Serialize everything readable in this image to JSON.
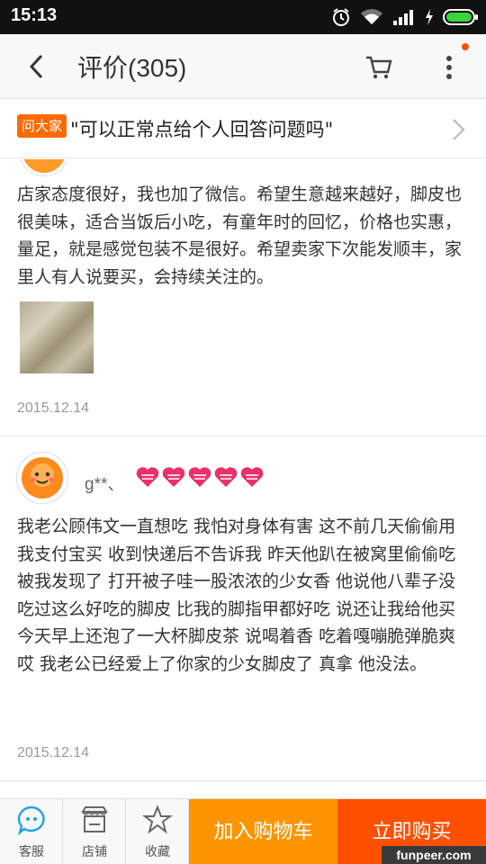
{
  "status_bar": {
    "time": "15:13"
  },
  "header": {
    "title": "评价(305)"
  },
  "ask": {
    "badge": "问大家",
    "question": "\"可以正常点给个人回答问题吗\""
  },
  "reviews": [
    {
      "text": "店家态度很好，我也加了微信。希望生意越来越好，脚皮也很美味，适合当饭后小吃，有童年时的回忆，价格也实惠，量足，就是感觉包装不是很好。希望卖家下次能发顺丰，家里人有人说要买，会持续关注的。",
      "date": "2015.12.14",
      "has_photo": true
    },
    {
      "user": "g**、",
      "level_hearts": 5,
      "text": "我老公顾伟文一直想吃 我怕对身体有害 这不前几天偷偷用我支付宝买 收到快递后不告诉我 昨天他趴在被窝里偷偷吃被我发现了 打开被子哇一股浓浓的少女香 他说他八辈子没吃过这么好吃的脚皮 比我的脚指甲都好吃 说还让我给他买 今天早上还泡了一大杯脚皮茶 说喝着香 吃着嘎嘣脆弹脆爽 哎 我老公已经爱上了你家的少女脚皮了 真拿 他没法。",
      "date": "2015.12.14"
    }
  ],
  "bottom_bar": {
    "service_label": "客服",
    "shop_label": "店铺",
    "favorite_label": "收藏",
    "add_cart_label": "加入购物车",
    "buy_now_label": "立即购买"
  },
  "watermark": "funpeer.com",
  "colors": {
    "accent_orange": "#ff9402",
    "accent_red": "#ff5000",
    "heart_pink": "#e8306a"
  }
}
